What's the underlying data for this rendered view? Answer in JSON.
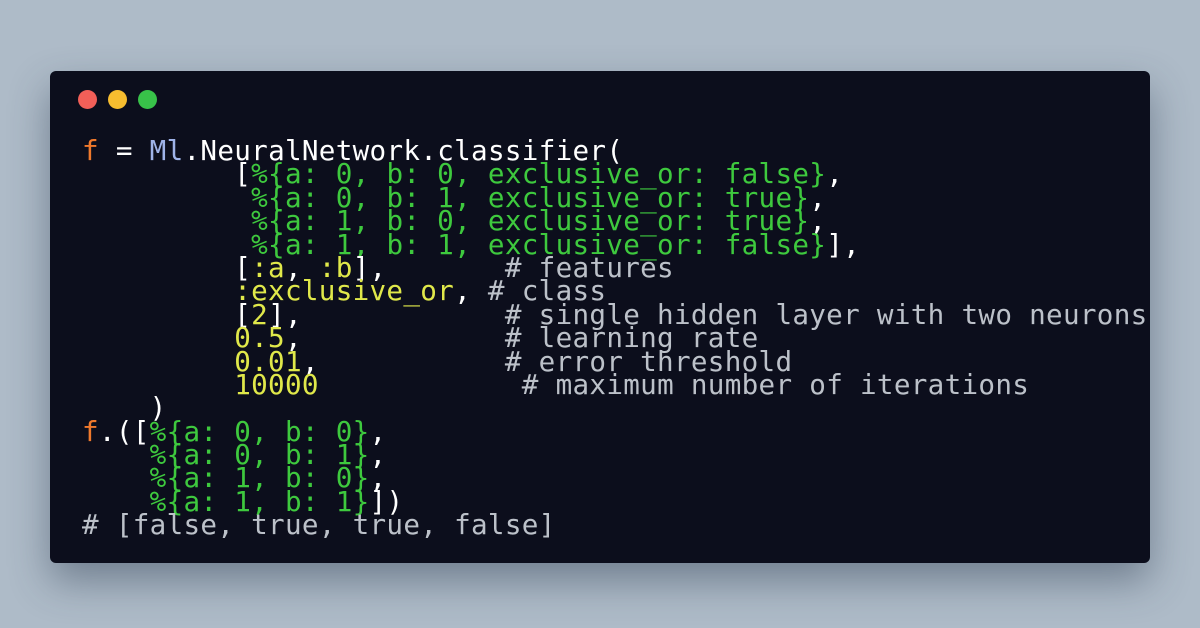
{
  "window": {
    "colors": {
      "close": "#f25f58",
      "minimize": "#f7bd2f",
      "zoom": "#38c249"
    }
  },
  "code": {
    "lines": [
      [
        {
          "cls": "var",
          "text": "f"
        },
        {
          "cls": "punct",
          "text": " = "
        },
        {
          "cls": "module",
          "text": "Ml"
        },
        {
          "cls": "punct",
          "text": "."
        },
        {
          "cls": "fn",
          "text": "NeuralNetwork"
        },
        {
          "cls": "punct",
          "text": "."
        },
        {
          "cls": "fn",
          "text": "classifier"
        },
        {
          "cls": "punct",
          "text": "("
        }
      ],
      [
        {
          "cls": "punct",
          "text": "         ["
        },
        {
          "cls": "map",
          "text": "%{a: 0, b: 0, exclusive_or: false}"
        },
        {
          "cls": "punct",
          "text": ","
        }
      ],
      [
        {
          "cls": "punct",
          "text": "          "
        },
        {
          "cls": "map",
          "text": "%{a: 0, b: 1, exclusive_or: true}"
        },
        {
          "cls": "punct",
          "text": ","
        }
      ],
      [
        {
          "cls": "punct",
          "text": "          "
        },
        {
          "cls": "map",
          "text": "%{a: 1, b: 0, exclusive_or: true}"
        },
        {
          "cls": "punct",
          "text": ","
        }
      ],
      [
        {
          "cls": "punct",
          "text": "          "
        },
        {
          "cls": "map",
          "text": "%{a: 1, b: 1, exclusive_or: false}"
        },
        {
          "cls": "punct",
          "text": "],"
        }
      ],
      [
        {
          "cls": "punct",
          "text": "         ["
        },
        {
          "cls": "atom",
          "text": ":a"
        },
        {
          "cls": "punct",
          "text": ", "
        },
        {
          "cls": "atom",
          "text": ":b"
        },
        {
          "cls": "punct",
          "text": "],       "
        },
        {
          "cls": "comment",
          "text": "# features"
        }
      ],
      [
        {
          "cls": "punct",
          "text": "         "
        },
        {
          "cls": "atom",
          "text": ":exclusive_or"
        },
        {
          "cls": "punct",
          "text": ", "
        },
        {
          "cls": "comment",
          "text": "# class"
        }
      ],
      [
        {
          "cls": "punct",
          "text": "         ["
        },
        {
          "cls": "num",
          "text": "2"
        },
        {
          "cls": "punct",
          "text": "],            "
        },
        {
          "cls": "comment",
          "text": "# single hidden layer with two neurons"
        }
      ],
      [
        {
          "cls": "punct",
          "text": "         "
        },
        {
          "cls": "num",
          "text": "0.5"
        },
        {
          "cls": "punct",
          "text": ",            "
        },
        {
          "cls": "comment",
          "text": "# learning rate"
        }
      ],
      [
        {
          "cls": "punct",
          "text": "         "
        },
        {
          "cls": "num",
          "text": "0.01"
        },
        {
          "cls": "punct",
          "text": ",           "
        },
        {
          "cls": "comment",
          "text": "# error threshold"
        }
      ],
      [
        {
          "cls": "punct",
          "text": "         "
        },
        {
          "cls": "num",
          "text": "10000"
        },
        {
          "cls": "punct",
          "text": "            "
        },
        {
          "cls": "comment",
          "text": "# maximum number of iterations"
        }
      ],
      [
        {
          "cls": "punct",
          "text": "    )"
        }
      ],
      [
        {
          "cls": "var",
          "text": "f"
        },
        {
          "cls": "punct",
          "text": ".(["
        },
        {
          "cls": "map",
          "text": "%{a: 0, b: 0}"
        },
        {
          "cls": "punct",
          "text": ","
        }
      ],
      [
        {
          "cls": "punct",
          "text": "    "
        },
        {
          "cls": "map",
          "text": "%{a: 0, b: 1}"
        },
        {
          "cls": "punct",
          "text": ","
        }
      ],
      [
        {
          "cls": "punct",
          "text": "    "
        },
        {
          "cls": "map",
          "text": "%{a: 1, b: 0}"
        },
        {
          "cls": "punct",
          "text": ","
        }
      ],
      [
        {
          "cls": "punct",
          "text": "    "
        },
        {
          "cls": "map",
          "text": "%{a: 1, b: 1}"
        },
        {
          "cls": "punct",
          "text": "])"
        }
      ],
      [
        {
          "cls": "comment",
          "text": "# [false, true, true, false]"
        }
      ]
    ]
  }
}
